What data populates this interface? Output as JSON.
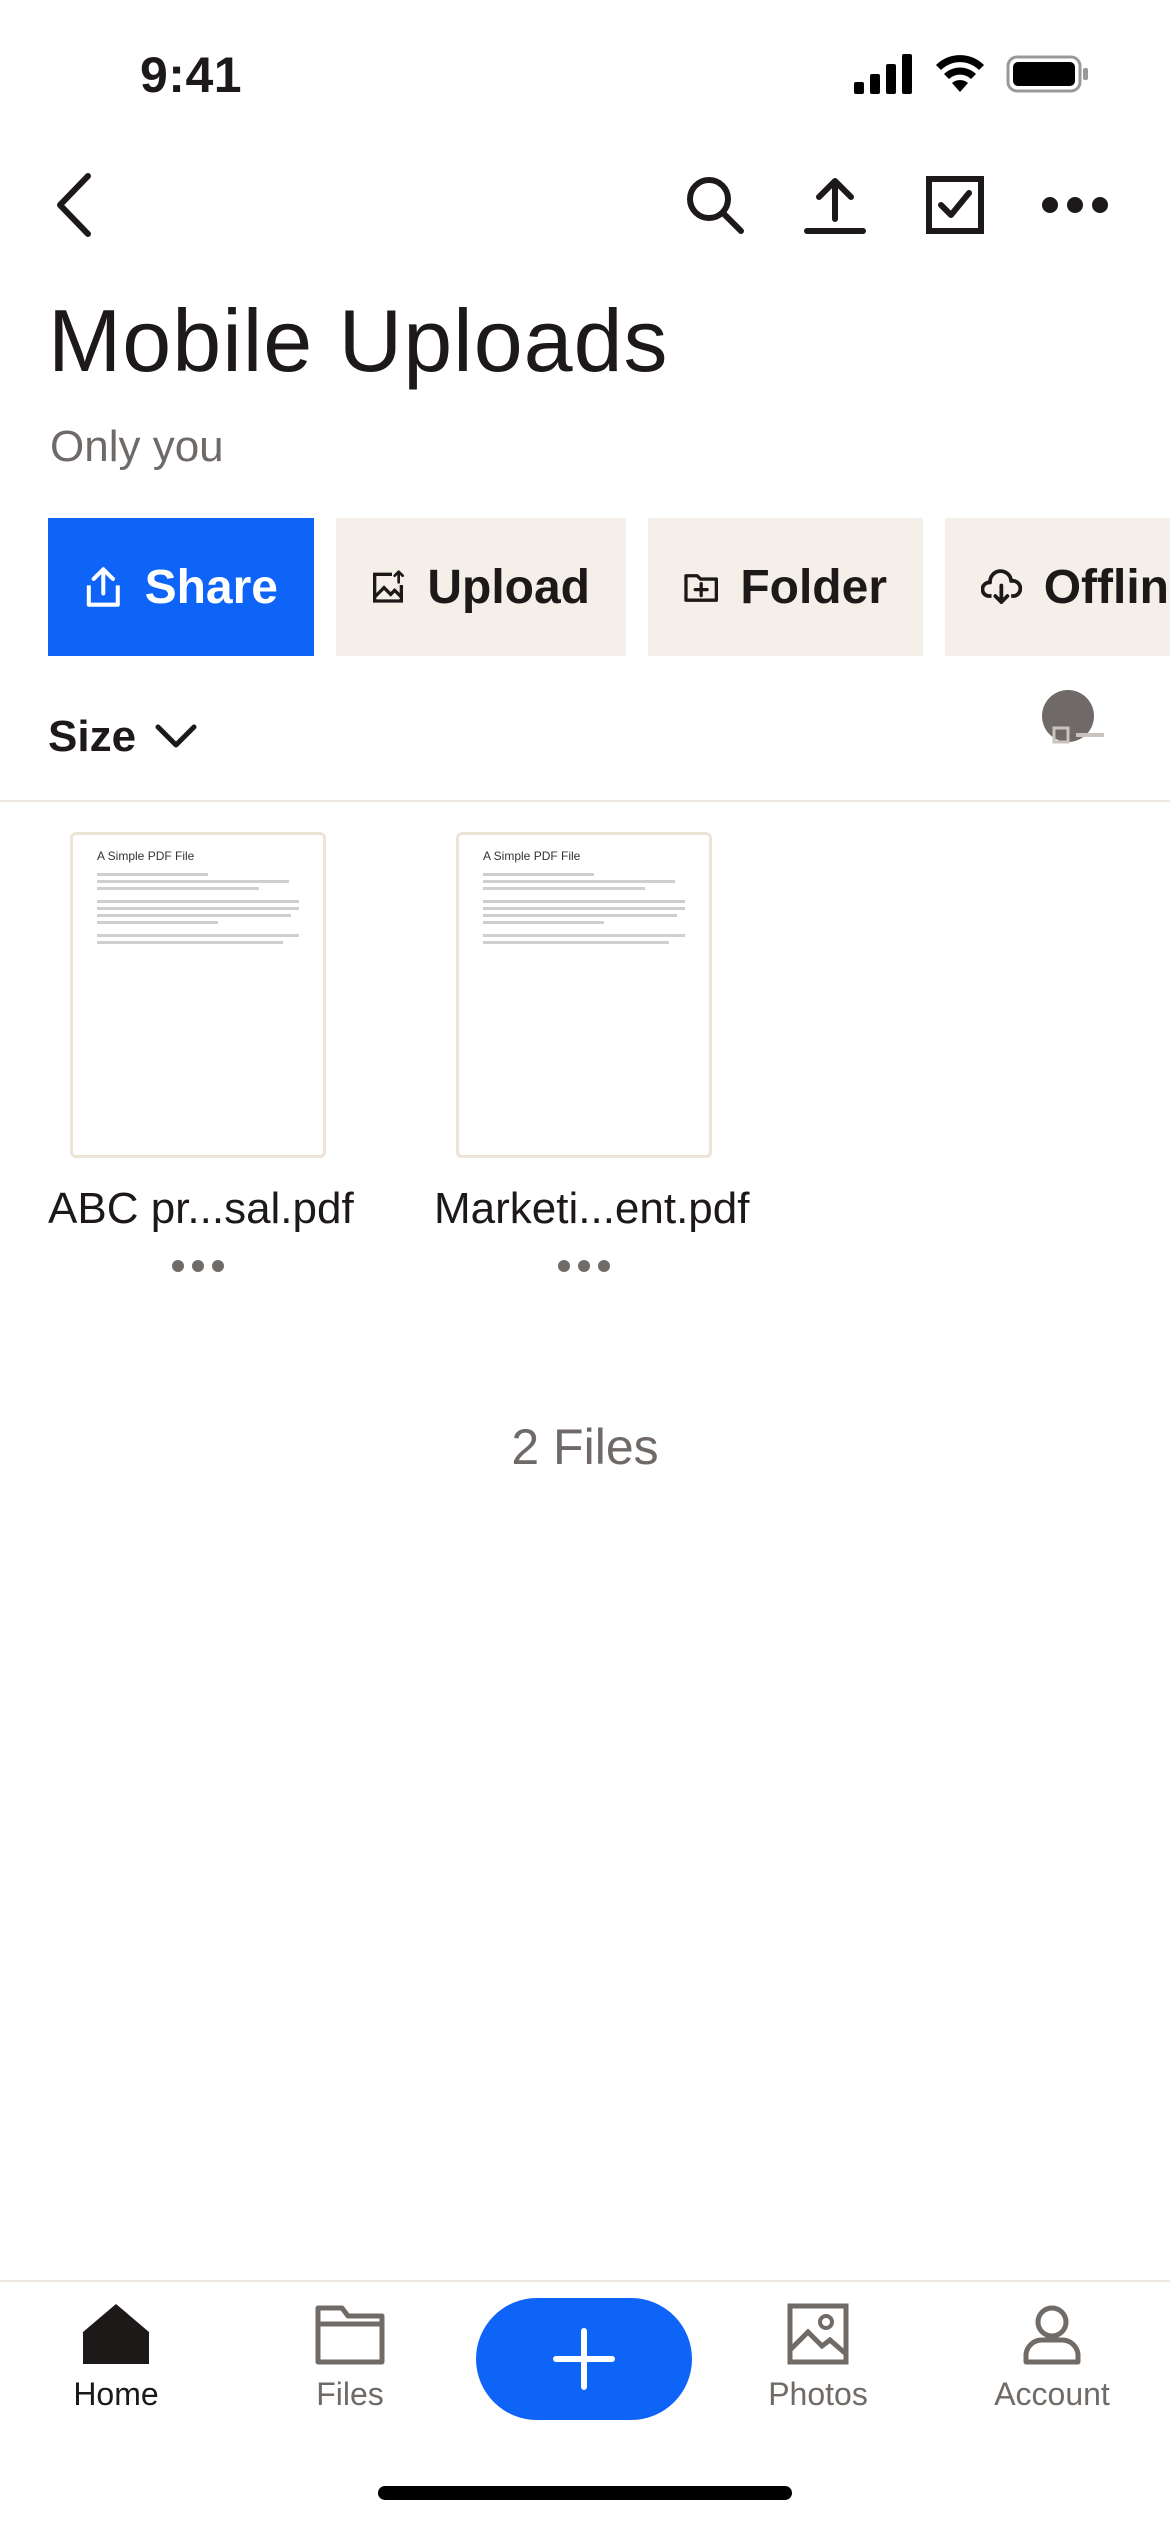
{
  "status": {
    "time": "9:41"
  },
  "nav": {
    "icons": [
      "back-icon",
      "search-icon",
      "upload-icon",
      "select-icon",
      "more-icon"
    ]
  },
  "header": {
    "title": "Mobile Uploads",
    "subtitle": "Only you"
  },
  "actions": [
    {
      "label": "Share",
      "icon": "share-icon"
    },
    {
      "label": "Upload",
      "icon": "upload-photo-icon"
    },
    {
      "label": "Folder",
      "icon": "new-folder-icon"
    },
    {
      "label": "Offlin",
      "icon": "offline-download-icon"
    }
  ],
  "sort": {
    "label": "Size"
  },
  "files": [
    {
      "name": "ABC pr...sal.pdf",
      "preview_title": "A Simple PDF File"
    },
    {
      "name": "Marketi...ent.pdf",
      "preview_title": "A Simple PDF File"
    }
  ],
  "file_count": "2 Files",
  "tabs": [
    {
      "label": "Home",
      "icon": "home-icon",
      "active": true
    },
    {
      "label": "Files",
      "icon": "folder-icon",
      "active": false
    },
    {
      "label": "Photos",
      "icon": "photos-icon",
      "active": false
    },
    {
      "label": "Account",
      "icon": "account-icon",
      "active": false
    }
  ],
  "colors": {
    "accent": "#0d64f7",
    "chip_bg": "#f4f0e9",
    "text": "#1e1919",
    "muted": "#6f6a67"
  }
}
